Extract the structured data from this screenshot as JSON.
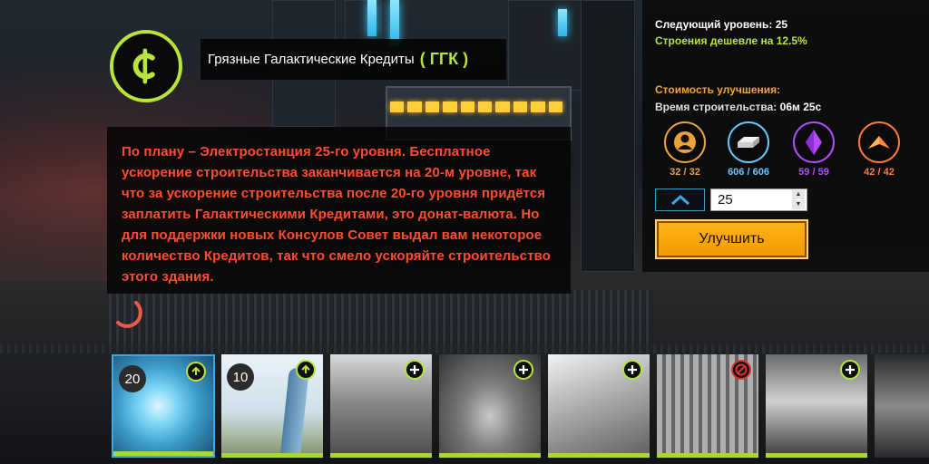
{
  "building": {
    "title": "Грязные Галактические Кредиты",
    "abbr": "( ГГК )",
    "description": "По плану – Электростанция 25-го уровня. Бесплатное ускорение строительства заканчивается на 20-м уровне, так что за ускорение строительства после 20-го уровня придётся заплатить Галактическими Кредитами, это донат-валюта. Но для поддержки новых Консулов Совет выдал вам некоторое количество Кредитов, так что смело ускоряйте строительство этого здания."
  },
  "upgrade_panel": {
    "next_level": "Следующий уровень: 25",
    "discount": "Строения дешевле на 12.5%",
    "cost_header": "Стоимость улучшения:",
    "build_time_label": "Время строительства:",
    "build_time_value": "06м 25с",
    "resources": [
      {
        "icon": "person-icon",
        "count": "32 / 32",
        "color": "#e8a33a"
      },
      {
        "icon": "metal-ingot-icon",
        "count": "606 / 606",
        "color": "#6ac6ff"
      },
      {
        "icon": "crystal-icon",
        "count": "59 / 59",
        "color": "#b34cff"
      },
      {
        "icon": "fuel-chevron-icon",
        "count": "42 / 42",
        "color": "#ff7a3a"
      }
    ],
    "level_input_value": "25",
    "upgrade_button": "Улучшить"
  },
  "thumbnails": [
    {
      "level": "20",
      "badge": "upgrade"
    },
    {
      "level": "10",
      "badge": "upgrade"
    },
    {
      "level": "",
      "badge": "add"
    },
    {
      "level": "",
      "badge": "add"
    },
    {
      "level": "",
      "badge": "add"
    },
    {
      "level": "",
      "badge": "blocked"
    },
    {
      "level": "",
      "badge": "add"
    }
  ],
  "colors": {
    "accent_green": "#b9e43a",
    "accent_orange": "#f39a00",
    "description_red": "#ff4d2e",
    "label_orange": "#f0a43a"
  }
}
